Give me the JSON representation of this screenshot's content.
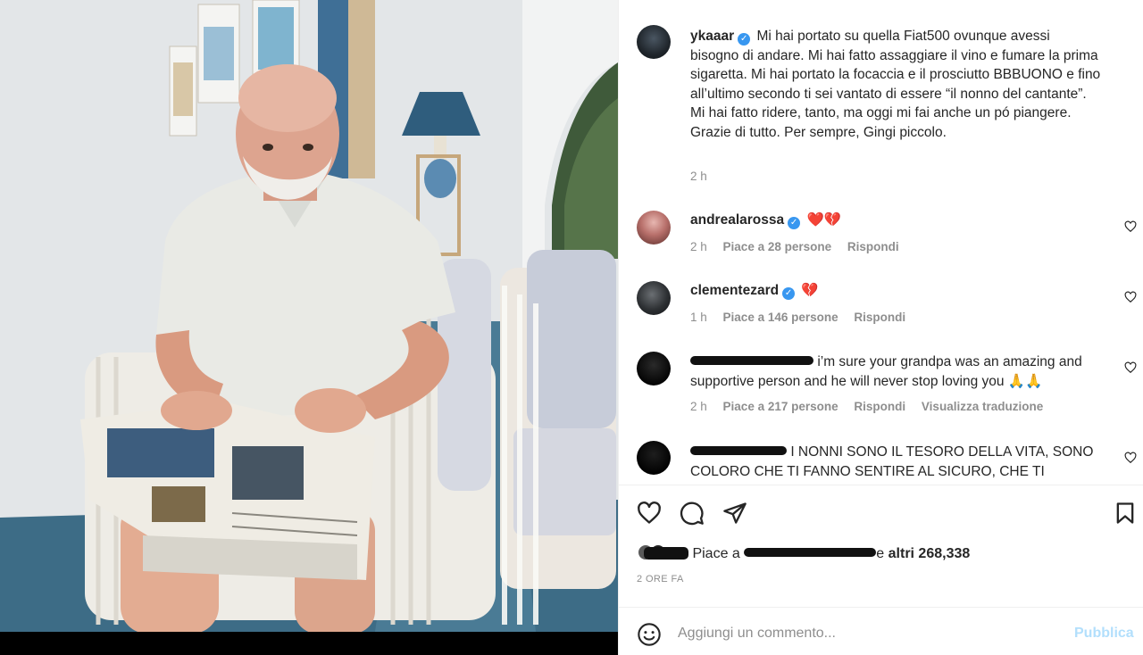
{
  "post": {
    "author": "ykaaar",
    "author_avatar": "user-avatar",
    "caption": "Mi hai portato su quella Fiat500 ovunque avessi bisogno di andare. Mi hai fatto assaggiare il vino e fumare la prima sigaretta. Mi hai portato la focaccia e il prosciutto BBBUONO e fino all’ultimo secondo ti sei vantato di essere “il nonno del cantante”. Mi hai fatto ridere, tanto, ma oggi mi fai anche un pó piangere. Grazie di tutto. Per sempre, Gingi piccolo.",
    "caption_time": "2 h",
    "posted_ago": "2 ORE FA"
  },
  "comments": [
    {
      "username": "andrealarossa",
      "verified": true,
      "text": "❤️💔",
      "time": "2 h",
      "likes": "Piace a 28 persone",
      "reply": "Rispondi"
    },
    {
      "username": "clementezard",
      "verified": true,
      "text": "💔",
      "time": "1 h",
      "likes": "Piace a 146 persone",
      "reply": "Rispondi"
    },
    {
      "username": "",
      "verified": false,
      "text": "i’m sure your grandpa was an amazing and supportive person and he will never stop loving you 🙏🙏",
      "time": "2 h",
      "likes": "Piace a 217 persone",
      "reply": "Rispondi",
      "translate": "Visualizza traduzione"
    },
    {
      "username": "",
      "verified": false,
      "text": "I NONNI SONO IL TESORO DELLA VITA, SONO COLORO CHE TI FANNO SENTIRE AL SICURO, CHE TI"
    }
  ],
  "likes_line": {
    "prefix": "Piace a",
    "suffix": "e",
    "others": "altri 268,338"
  },
  "comment_input": {
    "placeholder": "Aggiungi un commento...",
    "publish": "Pubblica"
  },
  "colors": {
    "link": "#3897f0",
    "publish_disabled": "#b2dffc",
    "muted": "#8e8e8e",
    "verified": "#3897f0"
  },
  "icons": [
    "heart-icon",
    "comment-icon",
    "share-icon",
    "bookmark-icon",
    "emoji-icon",
    "verified-icon"
  ]
}
